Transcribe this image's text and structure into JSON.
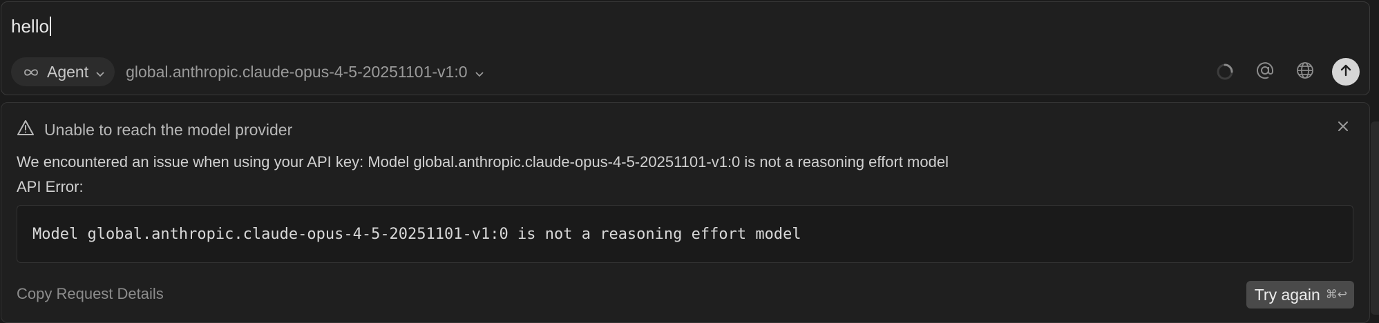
{
  "composer": {
    "input_value": "hello",
    "mode_label": "Agent",
    "model_label": "global.anthropic.claude-opus-4-5-20251101-v1:0"
  },
  "error": {
    "title": "Unable to reach the model provider",
    "message": "We encountered an issue when using your API key: Model global.anthropic.claude-opus-4-5-20251101-v1:0 is not a reasoning effort model",
    "detail_label": "API Error:",
    "code": "Model global.anthropic.claude-opus-4-5-20251101-v1:0 is not a reasoning effort model",
    "copy_label": "Copy Request Details",
    "retry_label": "Try again",
    "retry_shortcut": "⌘↩"
  },
  "icons": {
    "mode": "infinity-icon",
    "dropdown": "chevron-down-icon",
    "loading": "spinner-icon",
    "mention": "at-icon",
    "web": "globe-icon",
    "send": "arrow-up-icon",
    "warning": "warning-triangle-icon",
    "close": "close-icon"
  },
  "colors": {
    "background": "#1b1b1b",
    "panel": "#1f1f1f",
    "send_button": "#d6d6d6",
    "retry_button": "#4a4a4a"
  }
}
